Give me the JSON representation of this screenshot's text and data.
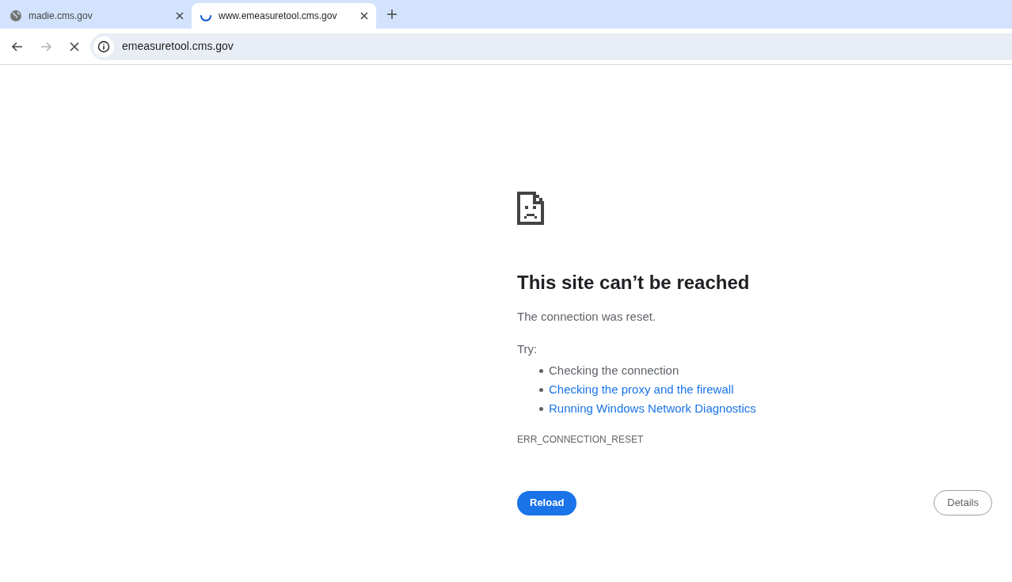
{
  "tabs": [
    {
      "title": "madie.cms.gov",
      "kind": "site",
      "selected": false
    },
    {
      "title": "www.emeasuretool.cms.gov",
      "kind": "loading",
      "selected": true
    }
  ],
  "nav_buttons": [
    {
      "kind": "back",
      "disabled": false
    },
    {
      "kind": "forward",
      "disabled": true
    },
    {
      "kind": "stop",
      "disabled": false
    }
  ],
  "address_bar": {
    "value": "emeasuretool.cms.gov"
  },
  "error": {
    "heading": "This site can’t be reached",
    "message": "The connection was reset.",
    "try_label": "Try:",
    "suggestions": [
      {
        "text": "Checking the connection",
        "kind": "text"
      },
      {
        "text": "Checking the proxy and the firewall",
        "kind": "link"
      },
      {
        "text": "Running Windows Network Diagnostics",
        "kind": "link"
      }
    ],
    "code": "ERR_CONNECTION_RESET"
  },
  "buttons": [
    {
      "label": "Reload",
      "kind": "primary"
    },
    {
      "label": "Details",
      "kind": "secondary"
    }
  ]
}
